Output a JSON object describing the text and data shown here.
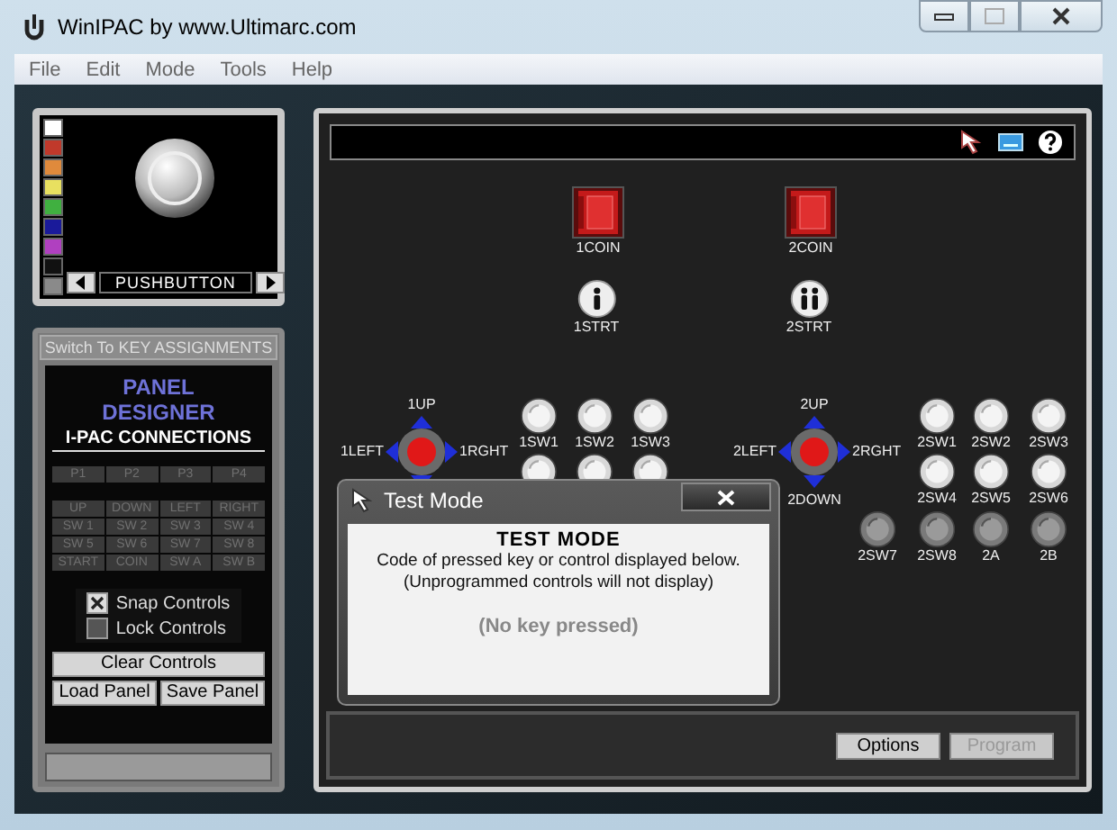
{
  "window": {
    "title": "WinIPAC by www.Ultimarc.com"
  },
  "menu": [
    "File",
    "Edit",
    "Mode",
    "Tools",
    "Help"
  ],
  "palette": {
    "swatches": [
      {
        "color": "#ffffff"
      },
      {
        "color": "#c0392b"
      },
      {
        "color": "#e08a3c"
      },
      {
        "color": "#e8e060"
      },
      {
        "color": "#40b040"
      },
      {
        "color": "#1a1a9a"
      },
      {
        "color": "#b040c0"
      },
      {
        "color": "#111111"
      },
      {
        "color": "#8a8a8a"
      }
    ],
    "control_name": "PUSHBUTTON"
  },
  "sidebar": {
    "switch_button": "Switch To KEY ASSIGNMENTS",
    "heading": "PANEL DESIGNER",
    "subheading": "I-PAC CONNECTIONS",
    "players": [
      "P1",
      "P2",
      "P3",
      "P4"
    ],
    "connections": [
      [
        "UP",
        "DOWN",
        "LEFT",
        "RIGHT"
      ],
      [
        "SW 1",
        "SW 2",
        "SW 3",
        "SW 4"
      ],
      [
        "SW 5",
        "SW 6",
        "SW 7",
        "SW 8"
      ],
      [
        "START",
        "COIN",
        "SW A",
        "SW B"
      ]
    ],
    "options": [
      {
        "label": "Snap Controls",
        "checked": true
      },
      {
        "label": "Lock Controls",
        "checked": false
      }
    ],
    "clear_button": "Clear Controls",
    "load_button": "Load Panel",
    "save_button": "Save Panel"
  },
  "canvas": {
    "controls": [
      {
        "kind": "coin",
        "label": "1COIN"
      },
      {
        "kind": "coin",
        "label": "2COIN"
      },
      {
        "kind": "start1",
        "label": "1STRT"
      },
      {
        "kind": "start2",
        "label": "2STRT"
      },
      {
        "kind": "joystick",
        "up": "1UP",
        "left": "1LEFT",
        "right": "1RGHT"
      },
      {
        "kind": "button",
        "label": "1SW1"
      },
      {
        "kind": "button",
        "label": "1SW2"
      },
      {
        "kind": "button",
        "label": "1SW3"
      },
      {
        "kind": "button"
      },
      {
        "kind": "button"
      },
      {
        "kind": "button"
      },
      {
        "kind": "joystick",
        "up": "2UP",
        "left": "2LEFT",
        "right": "2RGHT",
        "down": "2DOWN"
      },
      {
        "kind": "button",
        "label": "2SW1"
      },
      {
        "kind": "button",
        "label": "2SW2"
      },
      {
        "kind": "button",
        "label": "2SW3"
      },
      {
        "kind": "button",
        "label": "2SW4"
      },
      {
        "kind": "button",
        "label": "2SW5"
      },
      {
        "kind": "button",
        "label": "2SW6"
      },
      {
        "kind": "dark_button",
        "label": "2SW7"
      },
      {
        "kind": "dark_button",
        "label": "2SW8"
      },
      {
        "kind": "dark_button",
        "label": "2A"
      },
      {
        "kind": "dark_button",
        "label": "2B"
      }
    ],
    "footer_buttons": [
      {
        "label": "Options",
        "disabled": false
      },
      {
        "label": "Program",
        "disabled": true
      }
    ]
  },
  "dialog": {
    "title": "Test Mode",
    "heading": "TEST MODE",
    "lines": [
      "Code of pressed key or control displayed below.",
      "(Unprogrammed controls will not display)"
    ],
    "status": "(No key pressed)"
  }
}
